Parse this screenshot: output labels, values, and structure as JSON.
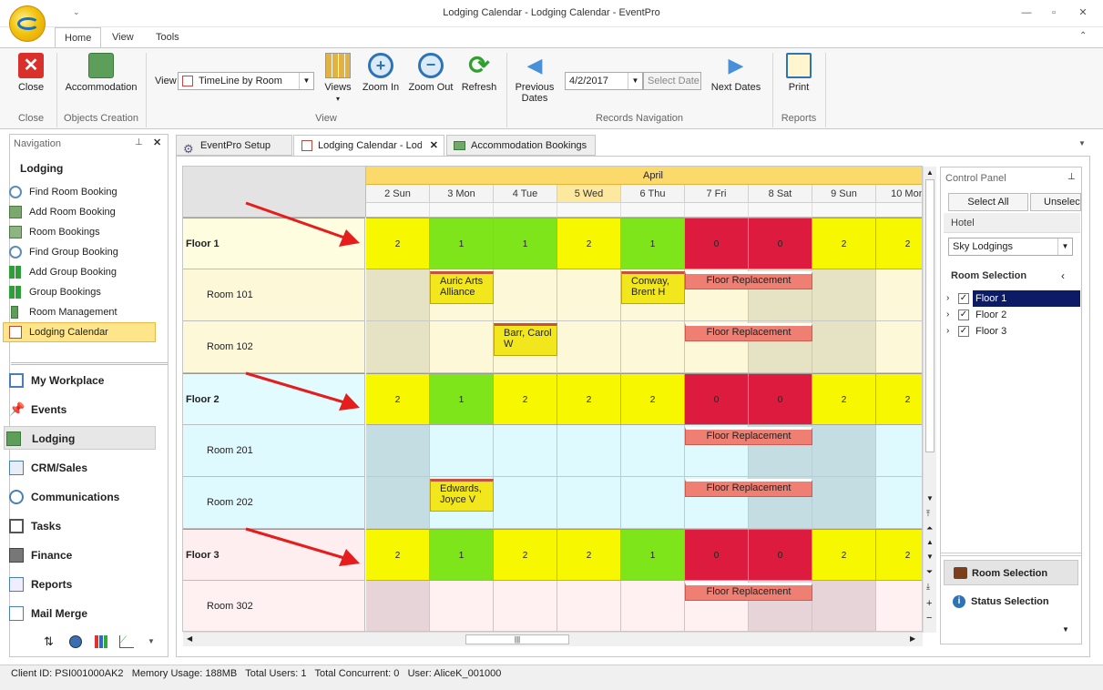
{
  "window": {
    "title": "Lodging Calendar - Lodging Calendar - EventPro"
  },
  "ribbon": {
    "tabs": [
      "Home",
      "View",
      "Tools"
    ],
    "close_label": "Close",
    "accommodation_label": "Accommodation",
    "view_label": "View",
    "view_value": "TimeLine by Room",
    "views_label": "Views",
    "zoom_in_label": "Zoom In",
    "zoom_out_label": "Zoom Out",
    "refresh_label": "Refresh",
    "prev_dates_label": "Previous Dates",
    "date_value": "4/2/2017",
    "select_date_label": "Select Date",
    "next_dates_label": "Next Dates",
    "print_label": "Print",
    "groups": [
      "Close",
      "Objects Creation",
      "View",
      "Records Navigation",
      "Reports"
    ]
  },
  "nav": {
    "header": "Navigation",
    "section": "Lodging",
    "items": [
      "Find Room Booking",
      "Add Room Booking",
      "Room Bookings",
      "Find Group Booking",
      "Add Group Booking",
      "Group Bookings",
      "Room Management",
      "Lodging Calendar"
    ],
    "modules": [
      "My Workplace",
      "Events",
      "Lodging",
      "CRM/Sales",
      "Communications",
      "Tasks",
      "Finance",
      "Reports",
      "Mail Merge"
    ]
  },
  "doc_tabs": [
    "EventPro Setup",
    "Lodging Calendar - Lodging Calendar",
    "Accommodation Bookings"
  ],
  "calendar": {
    "month": "April",
    "days": [
      "2 Sun",
      "3 Mon",
      "4 Tue",
      "5 Wed",
      "6 Thu",
      "7 Fri",
      "8 Sat",
      "9 Sun",
      "10 Mon"
    ],
    "floors": [
      {
        "name": "Floor 1",
        "counts": [
          "2",
          "1",
          "1",
          "2",
          "1",
          "0",
          "0",
          "2",
          "2"
        ],
        "rooms": [
          "Room 101",
          "Room 102"
        ]
      },
      {
        "name": "Floor 2",
        "counts": [
          "2",
          "1",
          "2",
          "2",
          "2",
          "0",
          "0",
          "2",
          "2"
        ],
        "rooms": [
          "Room 201",
          "Room 202"
        ]
      },
      {
        "name": "Floor 3",
        "counts": [
          "2",
          "1",
          "2",
          "2",
          "1",
          "0",
          "0",
          "2",
          "2"
        ],
        "rooms": [
          "Room 302"
        ]
      }
    ],
    "bookings": {
      "auric": "Auric Arts Alliance",
      "conway": "Conway, Brent H",
      "barr": "Barr, Carol W",
      "edwards": "Edwards, Joyce V",
      "floor_replacement": "Floor Replacement"
    }
  },
  "control_panel": {
    "title": "Control Panel",
    "select_all": "Select All",
    "unselect": "Unselect",
    "hotel_label": "Hotel",
    "hotel_value": "Sky Lodgings",
    "room_selection": "Room Selection",
    "floors": [
      "Floor 1",
      "Floor 2",
      "Floor 3"
    ],
    "room_selection_btn": "Room Selection",
    "status_selection_btn": "Status Selection"
  },
  "status_bar": {
    "client_id": "Client ID: PSI001000AK2",
    "memory": "Memory Usage: 188MB",
    "total_users": "Total Users: 1",
    "total_concurrent": "Total Concurrent: 0",
    "user": "User: AliceK_001000"
  },
  "colors": {
    "available": "#f7f700",
    "partial": "#7ee51a",
    "full": "#dd1b3e"
  }
}
